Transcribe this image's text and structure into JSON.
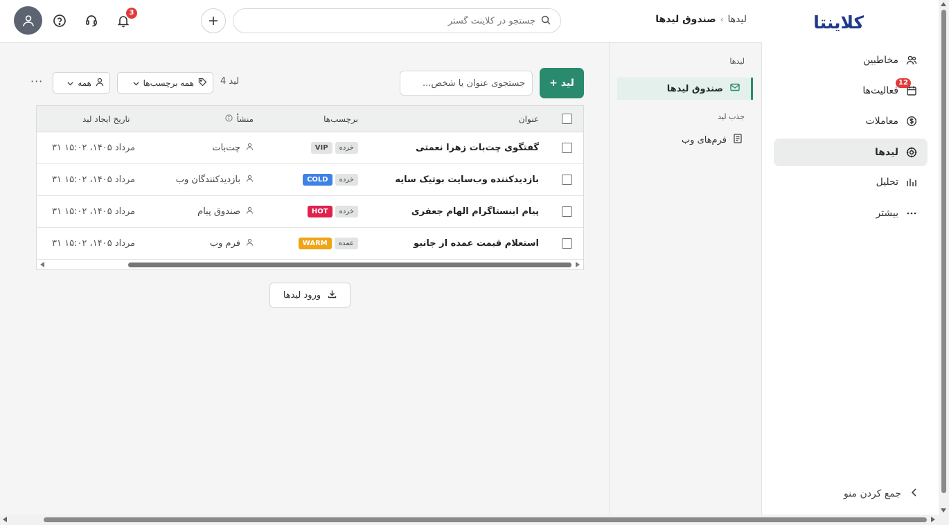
{
  "brand": {
    "logo_text": "کلاینتا",
    "color": "#1e3a8a"
  },
  "sidebar": {
    "items": [
      {
        "label": "مخاطبین",
        "icon": "users-icon"
      },
      {
        "label": "فعالیت‌ها",
        "icon": "calendar-icon",
        "badge": "12"
      },
      {
        "label": "معاملات",
        "icon": "dollar-circle-icon"
      },
      {
        "label": "لیدها",
        "icon": "target-icon",
        "active": true
      },
      {
        "label": "تحلیل",
        "icon": "bar-chart-icon"
      },
      {
        "label": "بیشتر",
        "icon": "more-icon"
      }
    ],
    "collapse_label": "جمع کردن منو"
  },
  "header": {
    "breadcrumb": {
      "parent": "لیدها",
      "current": "صندوق لیدها"
    },
    "search_placeholder": "جستجو در کلاینت گستر",
    "notification_count": "3"
  },
  "subpanel": {
    "section1_title": "لیدها",
    "inbox_label": "صندوق لیدها",
    "section2_title": "جذب لید",
    "webforms_label": "فرم‌های وب"
  },
  "toolbar": {
    "add_lead_label": "+ لید",
    "search_placeholder": "جستجوی عنوان یا شخص...",
    "lead_count": "4 لید",
    "tags_filter": "همه برچسب‌ها",
    "owner_filter": "همه",
    "more": "···"
  },
  "table": {
    "headers": {
      "title": "عنوان",
      "tags": "برچسب‌ها",
      "origin": "منشأ",
      "created": "تاریخ ایجاد لید"
    },
    "rows": [
      {
        "title": "گفتگوی چت‌بات زهرا نعمتی",
        "tag_segment": "خرده",
        "tag_temp": "VIP",
        "temp_style": "dark",
        "origin": "چت‌بات",
        "created": "۳۱ مرداد ۱۴۰۵، ۱۵:۰۲"
      },
      {
        "title": "بازدیدکننده وب‌سایت بوتیک سایه",
        "tag_segment": "خرده",
        "tag_temp": "COLD",
        "temp_style": "cold",
        "origin": "بازدیدکنندگان وب",
        "created": "۳۱ مرداد ۱۴۰۵، ۱۵:۰۲"
      },
      {
        "title": "پیام اینستاگرام الهام جعفری",
        "tag_segment": "خرده",
        "tag_temp": "HOT",
        "temp_style": "hot",
        "origin": "صندوق پیام",
        "created": "۳۱ مرداد ۱۴۰۵، ۱۵:۰۲"
      },
      {
        "title": "استعلام قیمت عمده از جانبو",
        "tag_segment": "عمده",
        "tag_temp": "WARM",
        "temp_style": "warm",
        "origin": "فرم وب",
        "created": "۳۱ مرداد ۱۴۰۵، ۱۵:۰۲"
      }
    ]
  },
  "import_label": "ورود لیدها",
  "colors": {
    "accent": "#2a8a6e",
    "hot": "#e0214d",
    "cold": "#3f82e6",
    "warm": "#f0a417",
    "badge": "#e03b3b"
  }
}
